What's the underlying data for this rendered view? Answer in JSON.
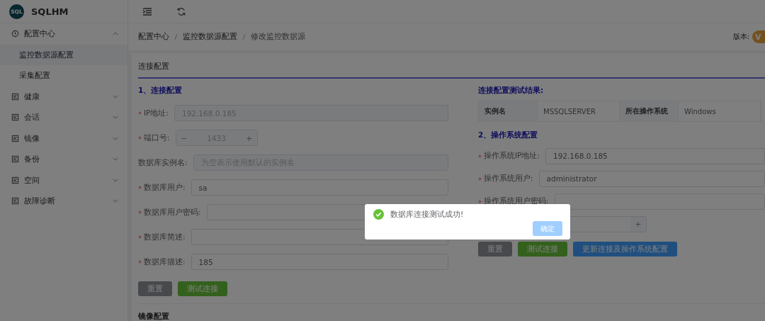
{
  "app": {
    "logo_text": "SQL",
    "title": "SQLHM"
  },
  "sidebar": {
    "items": [
      {
        "label": "配置中心",
        "kind": "clock",
        "expanded": true,
        "children": [
          {
            "label": "监控数据源配置",
            "selected": true
          },
          {
            "label": "采集配置",
            "selected": false
          }
        ]
      },
      {
        "label": "健康",
        "kind": "document",
        "expanded": false
      },
      {
        "label": "会话",
        "kind": "document",
        "expanded": false
      },
      {
        "label": "镜像",
        "kind": "document",
        "expanded": false
      },
      {
        "label": "备份",
        "kind": "document",
        "expanded": false
      },
      {
        "label": "空间",
        "kind": "document",
        "expanded": false
      },
      {
        "label": "故障诊断",
        "kind": "document",
        "expanded": false
      }
    ]
  },
  "breadcrumb": [
    "配置中心",
    "监控数据源配置",
    "修改监控数据源"
  ],
  "version": {
    "label": "版本:",
    "badge": "V"
  },
  "section_title": "连接配置",
  "left": {
    "heading": "1、连接配置",
    "fields": [
      {
        "label": "IP地址:",
        "required": true,
        "kind": "text",
        "value": "192.168.0.185",
        "disabled": true
      },
      {
        "label": "端口号:",
        "required": true,
        "kind": "number",
        "value": "1433",
        "minus": "−",
        "plus": "+",
        "disabled": true
      },
      {
        "label": "数据库实例名:",
        "required": false,
        "kind": "text",
        "placeholder": "为空表示使用默认的实例名",
        "disabled": true
      },
      {
        "label": "数据库用户:",
        "required": true,
        "kind": "text",
        "value": "sa",
        "disabled": false
      },
      {
        "label": "数据库用户密码:",
        "required": true,
        "kind": "text",
        "disabled": false
      },
      {
        "label": "数据库简述:",
        "required": true,
        "kind": "text",
        "disabled": false
      },
      {
        "label": "数据库描述:",
        "required": true,
        "kind": "text",
        "value": "185",
        "disabled": false
      }
    ],
    "buttons": [
      {
        "kind": "reset",
        "label": "重置"
      },
      {
        "kind": "test",
        "label": "测试连接"
      }
    ]
  },
  "right": {
    "result_title": "连接配置测试结果:",
    "result": [
      {
        "label": "实例名",
        "value": "MSSQLSERVER"
      },
      {
        "label": "所在操作系统",
        "value": "Windows"
      }
    ],
    "heading": "2、操作系统配置",
    "fields": [
      {
        "label": "操作系统IP地址:",
        "required": true,
        "kind": "text",
        "value": "192.168.0.185",
        "disabled": false
      },
      {
        "label": "操作系统用户:",
        "required": true,
        "kind": "text",
        "value": "administrator",
        "disabled": false
      },
      {
        "label": "操作系统用户密码:",
        "required": true,
        "kind": "text",
        "disabled": false
      },
      {
        "required": false,
        "kind": "number",
        "plus": "+"
      }
    ],
    "buttons": [
      {
        "kind": "reset",
        "label": "重置"
      },
      {
        "kind": "test",
        "label": "测试连接"
      },
      {
        "kind": "save",
        "label": "更新连接及操作系统配置"
      }
    ]
  },
  "next_section": "镜像配置",
  "dialog": {
    "message": "数据库连接测试成功!",
    "ok": "确定"
  }
}
